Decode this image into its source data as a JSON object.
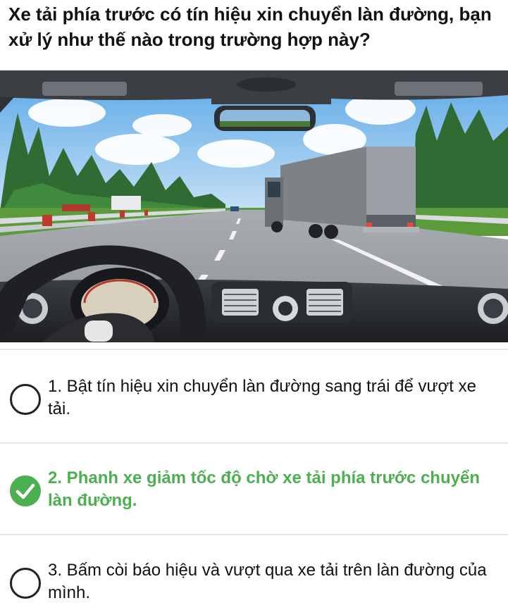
{
  "question": {
    "text": "Xe tải phía trước có tín hiệu xin chuyển làn đường, bạn xử lý như thế nào trong trường hợp này?"
  },
  "options": [
    {
      "label": "1. Bật tín hiệu xin chuyển làn đường sang trái để vượt xe tải.",
      "selected": false,
      "correct": false
    },
    {
      "label": "2. Phanh xe giảm tốc độ chờ xe tải phía trước chuyển làn đường.",
      "selected": true,
      "correct": true
    },
    {
      "label": "3. Bấm còi báo hiệu và vượt qua xe tải trên làn đường của mình.",
      "selected": false,
      "correct": false
    }
  ],
  "colors": {
    "correct": "#4caf50",
    "text": "#111111",
    "divider": "#e6e6e6"
  },
  "icons": {
    "unselected": "radio-empty-icon",
    "selected": "check-circle-icon"
  }
}
